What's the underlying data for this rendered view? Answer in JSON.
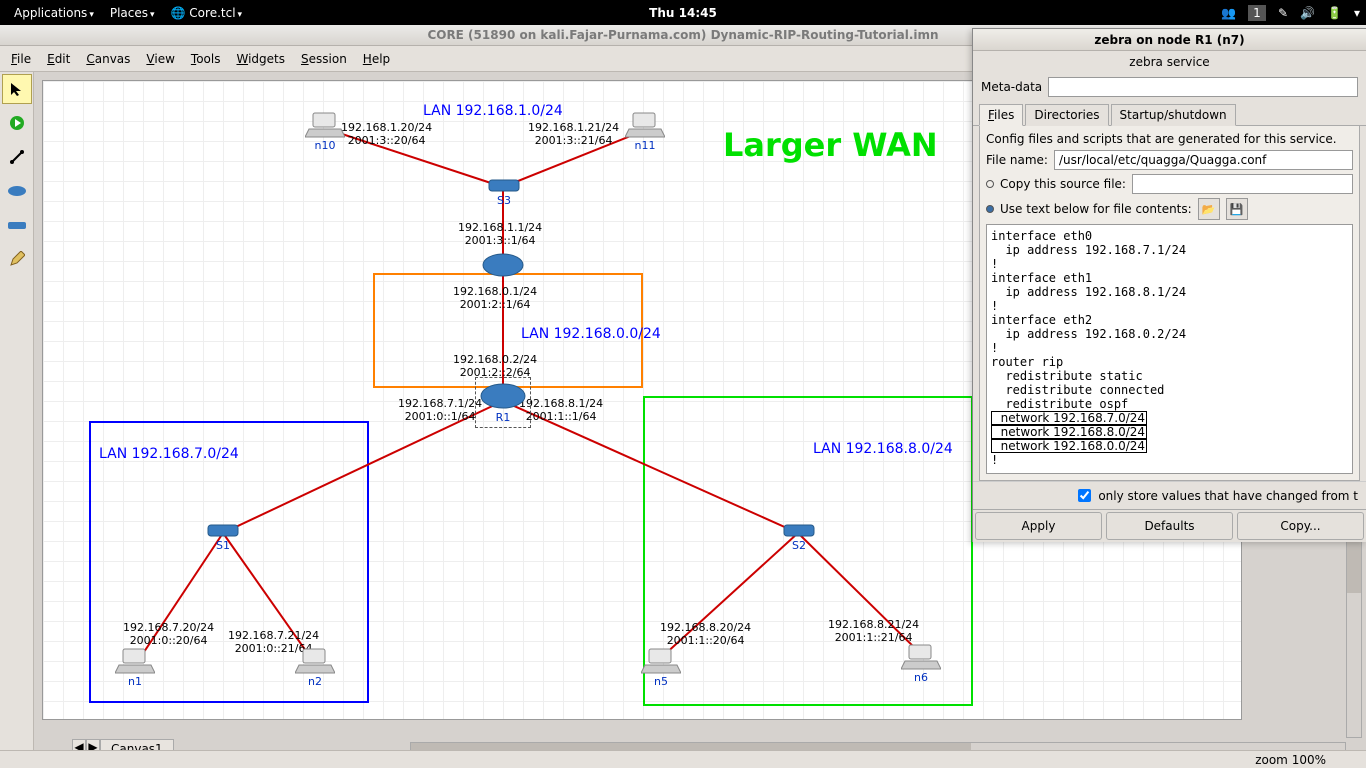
{
  "system": {
    "menus": {
      "apps": "Applications",
      "places": "Places",
      "app": "Core.tcl"
    },
    "clock": "Thu 14:45",
    "workspace": "1"
  },
  "window": {
    "title": "CORE (51890 on kali.Fajar-Purnama.com) Dynamic-RIP-Routing-Tutorial.imn",
    "menu": {
      "file": "File",
      "edit": "Edit",
      "canvas": "Canvas",
      "view": "View",
      "tools": "Tools",
      "widgets": "Widgets",
      "session": "Session",
      "help": "Help"
    },
    "tab": "Canvas1",
    "zoom": "zoom 100%"
  },
  "canvas": {
    "wan_label": "Larger WAN",
    "lans": {
      "top": "LAN 192.168.1.0/24",
      "mid": "LAN 192.168.0.0/24",
      "left": "LAN 192.168.7.0/24",
      "right": "LAN 192.168.8.0/24"
    },
    "ip": {
      "n10": "192.168.1.20/24\n2001:3::20/64",
      "n11": "192.168.1.21/24\n2001:3::21/64",
      "s3r": "192.168.1.1/24\n2001:3::1/64",
      "r2t": "192.168.0.1/24\n2001:2::1/64",
      "r2b": "192.168.0.2/24\n2001:2::2/64",
      "r1l": "192.168.7.1/24\n2001:0::1/64",
      "r1r": "192.168.8.1/24\n2001:1::1/64",
      "n1": "192.168.7.20/24\n2001:0::20/64",
      "n2": "192.168.7.21/24\n2001:0::21/64",
      "n5": "192.168.8.20/24\n2001:1::20/64",
      "n6": "192.168.8.21/24\n2001:1::21/64"
    },
    "nodes": {
      "n10": "n10",
      "n11": "n11",
      "s3": "S3",
      "r2": "",
      "r1": "R1",
      "s1": "S1",
      "s2": "S2",
      "n1": "n1",
      "n2": "n2",
      "n5": "n5",
      "n6": "n6"
    }
  },
  "dialog": {
    "title": "zebra on node R1 (n7)",
    "service": "zebra service",
    "meta_label": "Meta-data",
    "tabs": {
      "files": "Files",
      "dirs": "Directories",
      "startup": "Startup/shutdown"
    },
    "desc": "Config files and scripts that are generated for this service.",
    "filename_label": "File name:",
    "filename": "/usr/local/etc/quagga/Quagga.conf",
    "copy_label": "Copy this source file:",
    "usebelow_label": "Use text below for file contents:",
    "only_store": "only store values that have changed from t",
    "btns": {
      "apply": "Apply",
      "defaults": "Defaults",
      "copy": "Copy..."
    },
    "config_lines": [
      "interface eth0",
      "  ip address 192.168.7.1/24",
      "!",
      "interface eth1",
      "  ip address 192.168.8.1/24",
      "!",
      "interface eth2",
      "  ip address 192.168.0.2/24",
      "!",
      "router rip",
      "  redistribute static",
      "  redistribute connected",
      "  redistribute ospf"
    ],
    "config_hl": [
      {
        "text": "  network 192.168.7.0/24",
        "cls": "h-blue"
      },
      {
        "text": "  network 192.168.8.0/24",
        "cls": "h-green"
      },
      {
        "text": "  network 192.168.0.0/24",
        "cls": "h-orange"
      }
    ],
    "config_end": "!"
  }
}
